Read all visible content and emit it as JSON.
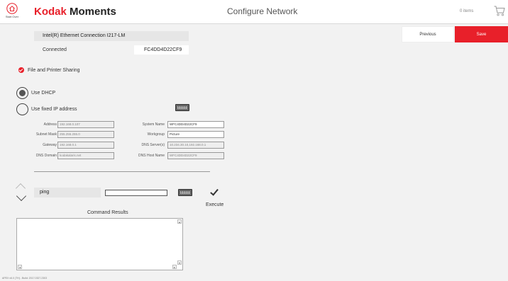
{
  "header": {
    "start_over_label": "Start Over",
    "brand_kodak": "Kodak",
    "brand_moments": "Moments",
    "title": "Configure Network",
    "cart_count": "0 items"
  },
  "actions": {
    "previous_label": "Previous",
    "save_label": "Save"
  },
  "adapter": {
    "name": "Intel(R) Ethernet Connection I217-LM",
    "status": "Connected",
    "mac": "FC4DD4D22CF9"
  },
  "sharing": {
    "label": "File and Printer Sharing",
    "checked": true
  },
  "ip_mode": {
    "dhcp_label": "Use DHCP",
    "fixed_label": "Use fixed IP address",
    "selected": "dhcp"
  },
  "fields": {
    "address_label": "Address",
    "address": "192.168.0.107",
    "subnet_label": "Subnet Mask",
    "subnet": "255.255.255.0",
    "gateway_label": "Gateway",
    "gateway": "192.168.0.1",
    "dns_domain_label": "DNS Domain",
    "dns_domain": "kodakalaris.net",
    "system_name_label": "System Name",
    "system_name": "WFC4DD4D22CF9",
    "workgroup_label": "Workgroup",
    "workgroup": "Picture",
    "dns_servers_label": "DNS Server(s)",
    "dns_servers": "10.234.30.10,192.168.0.1",
    "dns_host_label": "DNS Host Name",
    "dns_host": "WFC4DD4D22CF9"
  },
  "command": {
    "name": "ping",
    "argument": "",
    "execute_label": "Execute",
    "results_label": "Command Results",
    "results": ""
  },
  "footer": {
    "version": "APEX v6.0 (TH) - Build: 2017.0327.2303"
  },
  "colors": {
    "accent": "#e8202a",
    "background": "#f2f2f2"
  }
}
